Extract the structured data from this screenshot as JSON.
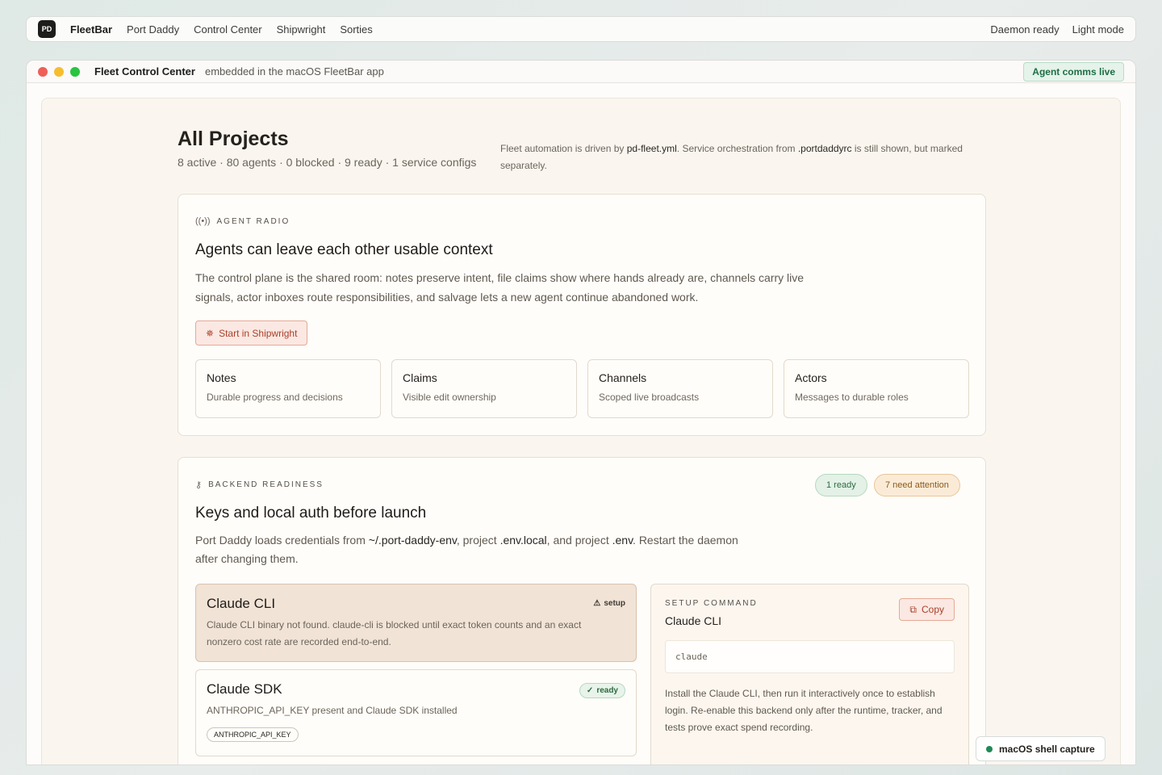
{
  "menubar": {
    "logo": "PD",
    "items": [
      "FleetBar",
      "Port Daddy",
      "Control Center",
      "Shipwright",
      "Sorties"
    ],
    "status": "Daemon ready",
    "theme": "Light mode"
  },
  "window": {
    "title": "Fleet Control Center",
    "subtitle": "embedded in the macOS FleetBar app",
    "live_badge": "Agent comms live"
  },
  "header": {
    "title": "All Projects",
    "stats": "8 active · 80 agents · 0 blocked · 9 ready · 1 service configs",
    "note_a": "Fleet automation is driven by ",
    "note_file1": "pd-fleet.yml",
    "note_b": ". Service orchestration from ",
    "note_file2": ".portdaddyrc",
    "note_c": " is still shown, but marked separately."
  },
  "agent_radio": {
    "eyebrow": "AGENT RADIO",
    "icon": "radio-waves-icon",
    "title": "Agents can leave each other usable context",
    "description": "The control plane is the shared room: notes preserve intent, file claims show where hands already are, channels carry live signals, actor inboxes route responsibilities, and salvage lets a new agent continue abandoned work.",
    "cta": "Start in Shipwright",
    "tiles": [
      {
        "title": "Notes",
        "subtitle": "Durable progress and decisions"
      },
      {
        "title": "Claims",
        "subtitle": "Visible edit ownership"
      },
      {
        "title": "Channels",
        "subtitle": "Scoped live broadcasts"
      },
      {
        "title": "Actors",
        "subtitle": "Messages to durable roles"
      }
    ]
  },
  "backend_readiness": {
    "eyebrow": "BACKEND READINESS",
    "icon": "key-icon",
    "ready_pill": "1 ready",
    "attention_pill": "7 need attention",
    "title": "Keys and local auth before launch",
    "desc_a": "Port Daddy loads credentials from ",
    "desc_path1": "~/.port-daddy-env",
    "desc_b": ", project ",
    "desc_path2": ".env.local",
    "desc_c": ", and project ",
    "desc_path3": ".env",
    "desc_d": ". Restart the daemon after changing them.",
    "backends": [
      {
        "name": "Claude CLI",
        "badge": "setup",
        "description": "Claude CLI binary not found. claude-cli is blocked until exact token counts and an exact nonzero cost rate are recorded end-to-end."
      },
      {
        "name": "Claude SDK",
        "badge": "ready",
        "description": "ANTHROPIC_API_KEY present and Claude SDK installed",
        "key": "ANTHROPIC_API_KEY"
      }
    ],
    "setup": {
      "label": "SETUP COMMAND",
      "title": "Claude CLI",
      "copy": "Copy",
      "command": "claude",
      "description": "Install the Claude CLI, then run it interactively once to establish login. Re-enable this backend only after the runtime, tracker, and tests prove exact spend recording."
    }
  },
  "capture_chip": "macOS shell capture",
  "colors": {
    "accent": "#a8402a",
    "ready": "#2d6b40",
    "attention": "#8a5a1e"
  }
}
